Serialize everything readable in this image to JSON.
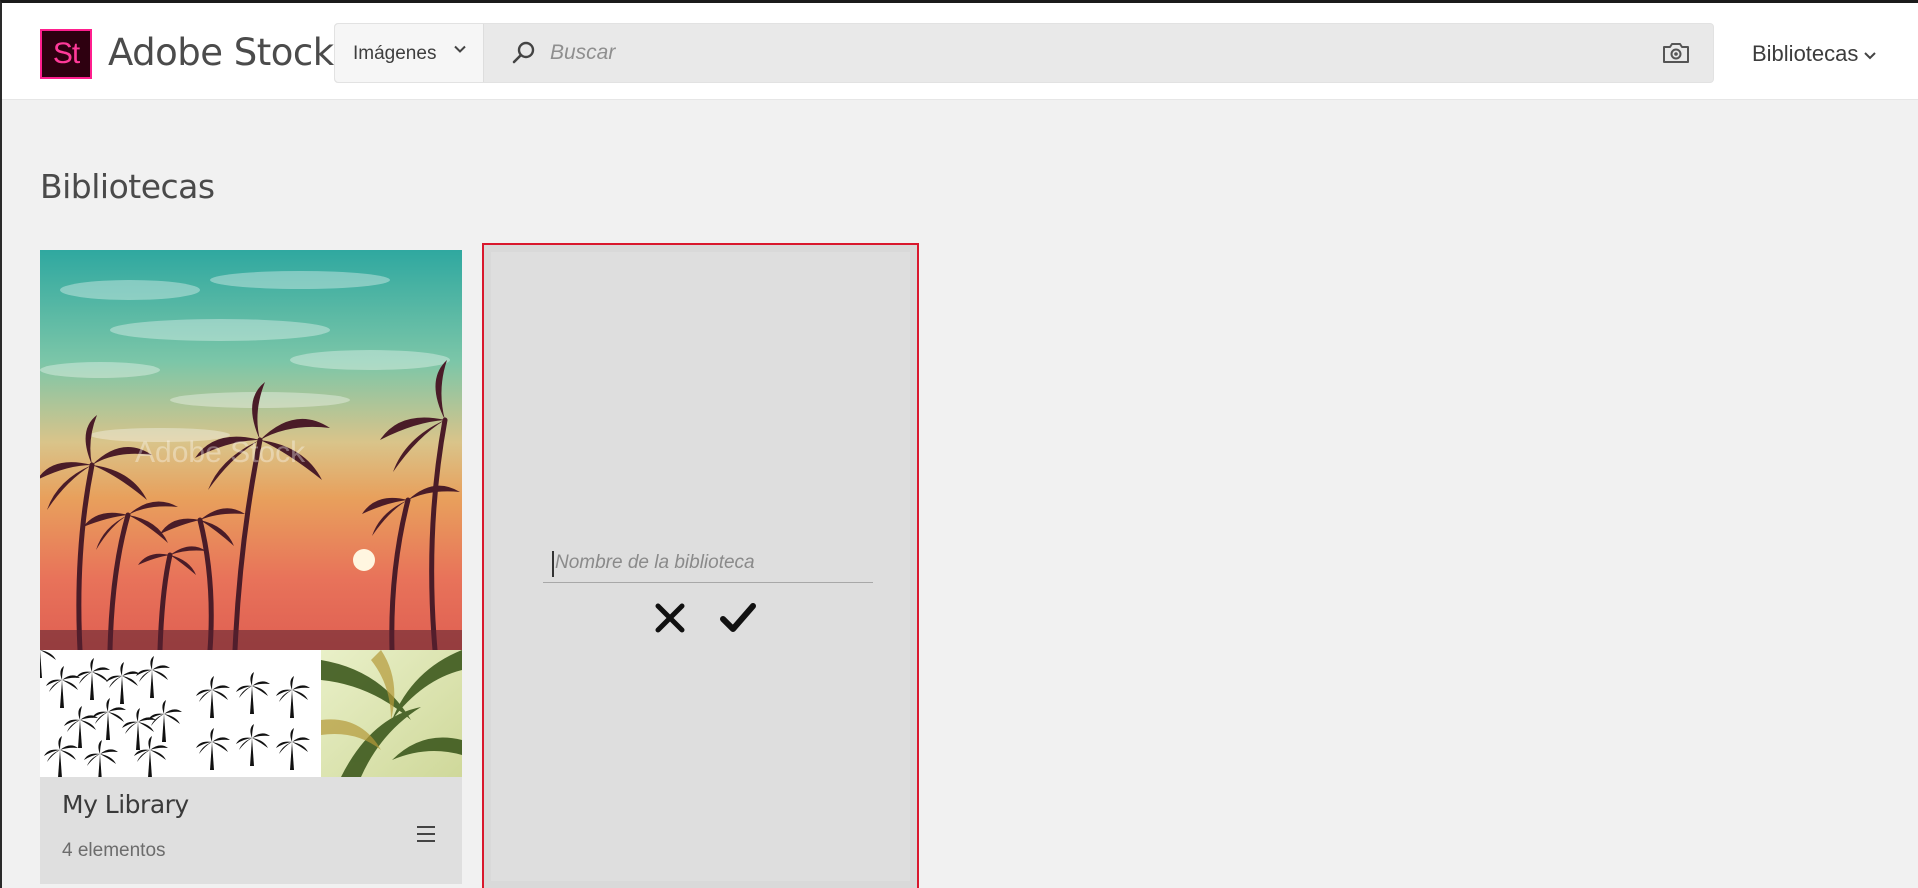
{
  "header": {
    "logo_text": "St",
    "brand": "Adobe Stock",
    "search_type": "Imágenes",
    "search_placeholder": "Buscar",
    "nav_libraries": "Bibliotecas"
  },
  "page": {
    "title": "Bibliotecas"
  },
  "libraries": [
    {
      "name": "My Library",
      "count": "4 elementos",
      "watermark": "Adobe Stock"
    }
  ],
  "new_library": {
    "placeholder": "Nombre de la biblioteca"
  },
  "colors": {
    "accent": "#ff1f8e",
    "logo_bg": "#2e0010",
    "selection_border": "#d9182d",
    "page_bg": "#f1f1f1"
  },
  "icons": {
    "search": "search-icon",
    "camera": "camera-icon",
    "chevron": "chevron-down-icon",
    "menu": "hamburger-menu-icon",
    "cancel": "close-icon",
    "confirm": "checkmark-icon"
  }
}
